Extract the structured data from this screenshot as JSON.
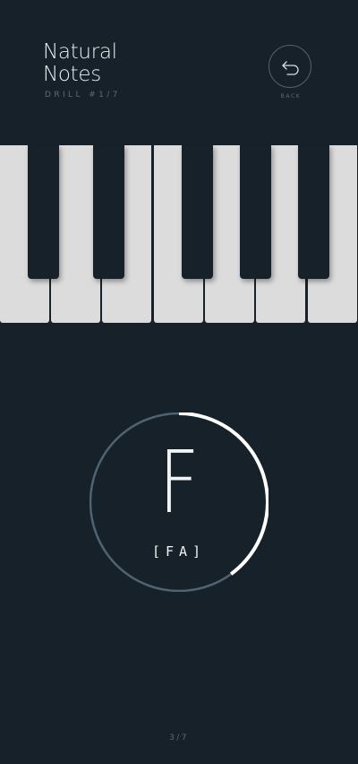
{
  "header": {
    "title_line1": "Natural",
    "title_line2": "Notes",
    "drill": "DRILL #1/7"
  },
  "back_button": {
    "label": "BACK",
    "icon": "undo-arrow-icon"
  },
  "keyboard": {
    "white_keys": 7,
    "black_keys": 5
  },
  "note": {
    "letter": "F",
    "solfege": "[FA]",
    "timer_progress": 0.4
  },
  "footer": {
    "counter": "3/7"
  },
  "colors": {
    "background": "#17212a",
    "white_key": "#dcdcdc",
    "ring_track": "#506370",
    "ring_progress": "#ffffff",
    "muted_text": "#5a6b78"
  }
}
